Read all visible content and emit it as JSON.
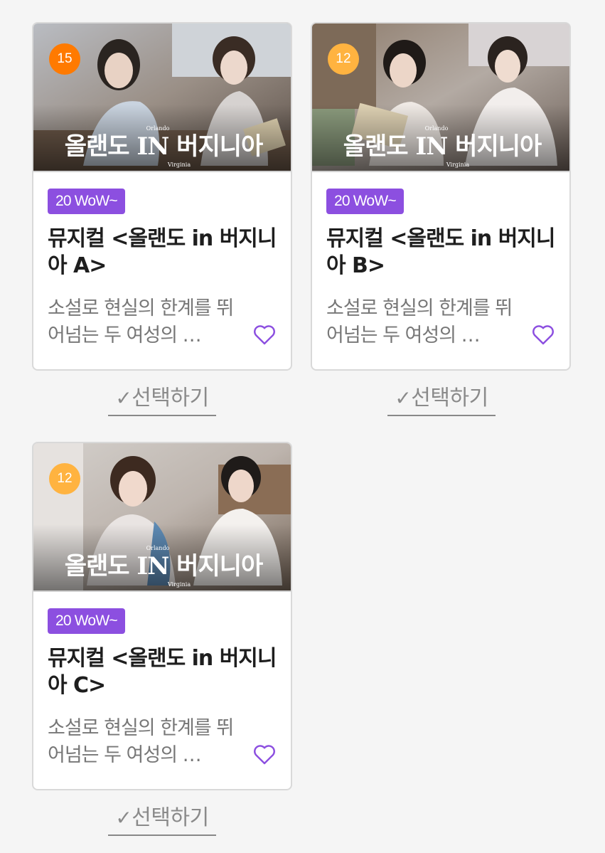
{
  "colors": {
    "accent": "#8c4fe0",
    "age_15": "#ff7a00",
    "age_12": "#ffb340",
    "heart": "#8c4fe0"
  },
  "cards": [
    {
      "age": "15",
      "poster_title": "올랜도 IN 버지니아",
      "poster_sub_top": "Orlando",
      "poster_sub_bottom": "Virginia",
      "badge": "20 WoW~",
      "title": "뮤지컬 <올랜도 in 버지니아 A>",
      "desc": "소설로 현실의 한계를 뛰어넘는 두 여성의 …",
      "select_check": "✓",
      "select_label": "선택하기"
    },
    {
      "age": "12",
      "poster_title": "올랜도 IN 버지니아",
      "poster_sub_top": "Orlando",
      "poster_sub_bottom": "Virginia",
      "badge": "20 WoW~",
      "title": "뮤지컬 <올랜도 in 버지니아 B>",
      "desc": "소설로 현실의 한계를 뛰어넘는 두 여성의 …",
      "select_check": "✓",
      "select_label": "선택하기"
    },
    {
      "age": "12",
      "poster_title": "올랜도 IN 버지니아",
      "poster_sub_top": "Orlando",
      "poster_sub_bottom": "Virginia",
      "badge": "20 WoW~",
      "title": "뮤지컬 <올랜도 in 버지니아 C>",
      "desc": "소설로 현실의 한계를 뛰어넘는 두 여성의 …",
      "select_check": "✓",
      "select_label": "선택하기"
    }
  ]
}
